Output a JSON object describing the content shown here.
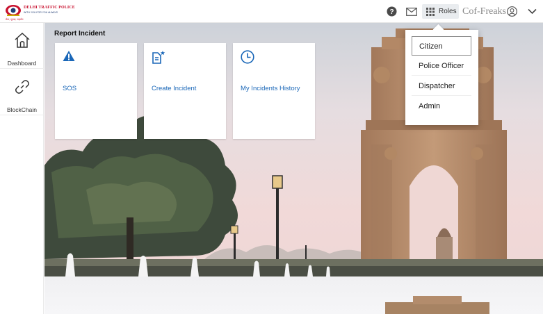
{
  "header": {
    "logo": {
      "title": "DELHI TRAFFIC POLICE",
      "tagline": "WITH YOU FOR YOU ALWAYS",
      "hindi_motto": "सेवा, सुरक्षा, सहयोग"
    },
    "icons": [
      "help-icon",
      "mail-icon",
      "grid-icon",
      "user-circle-icon",
      "chevron-down-icon"
    ],
    "roles_label": "Roles",
    "user_name": "Cof-Freaks"
  },
  "sidebar": {
    "items": [
      {
        "label": "Dashboard",
        "icon": "home-icon"
      },
      {
        "label": "BlockChain",
        "icon": "link-icon"
      }
    ]
  },
  "main": {
    "heading": "Report Incident",
    "tiles": [
      {
        "label": "SOS",
        "icon": "warning-icon"
      },
      {
        "label": "Create Incident",
        "icon": "new-document-icon"
      },
      {
        "label": "My Incidents History",
        "icon": "clock-icon"
      }
    ]
  },
  "roles_menu": {
    "selected": "Citizen",
    "items": [
      "Citizen",
      "Police Officer",
      "Dispatcher",
      "Admin"
    ]
  },
  "colors": {
    "accent": "#1a67b8",
    "topbar_bg": "#ffffff",
    "roles_button_bg": "#e9ecef",
    "brand_red": "#c8102e"
  }
}
